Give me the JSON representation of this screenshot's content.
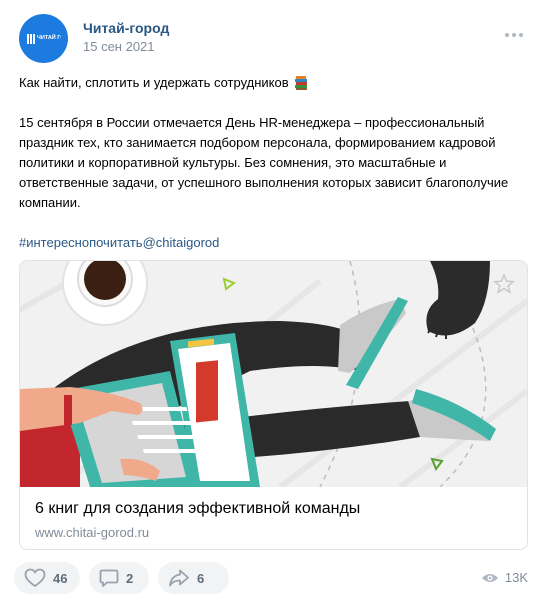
{
  "author": {
    "name": "Читай-город",
    "logo_text": "ЧИТАЙ ГОРОД",
    "logo_color": "#1d7be0"
  },
  "date": "15 сен 2021",
  "post": {
    "title": "Как найти, сплотить и удержать сотрудников",
    "title_emoji": "books-icon",
    "body": "15 сентября в России отмечается День HR-менеджера – профессиональный праздник тех, кто занимается подбором персонала, формированием кадровой политики и корпоративной культуры. Без сомнения, это масштабные и ответственные задачи, от успешного выполнения которых зависит благополучие компании.",
    "hashtag": "#интереснопочитать@chitaigorod"
  },
  "attachment": {
    "title": "6 книг для создания эффективной команды",
    "url": "www.chitai-gorod.ru",
    "image_icon": "laptop-illustration"
  },
  "actions": {
    "likes": "46",
    "comments": "2",
    "shares": "6",
    "views": "13K"
  },
  "colors": {
    "link": "#2a5885",
    "muted": "#818c99",
    "pill_bg": "#f2f3f5",
    "teal": "#3fb6a8"
  }
}
